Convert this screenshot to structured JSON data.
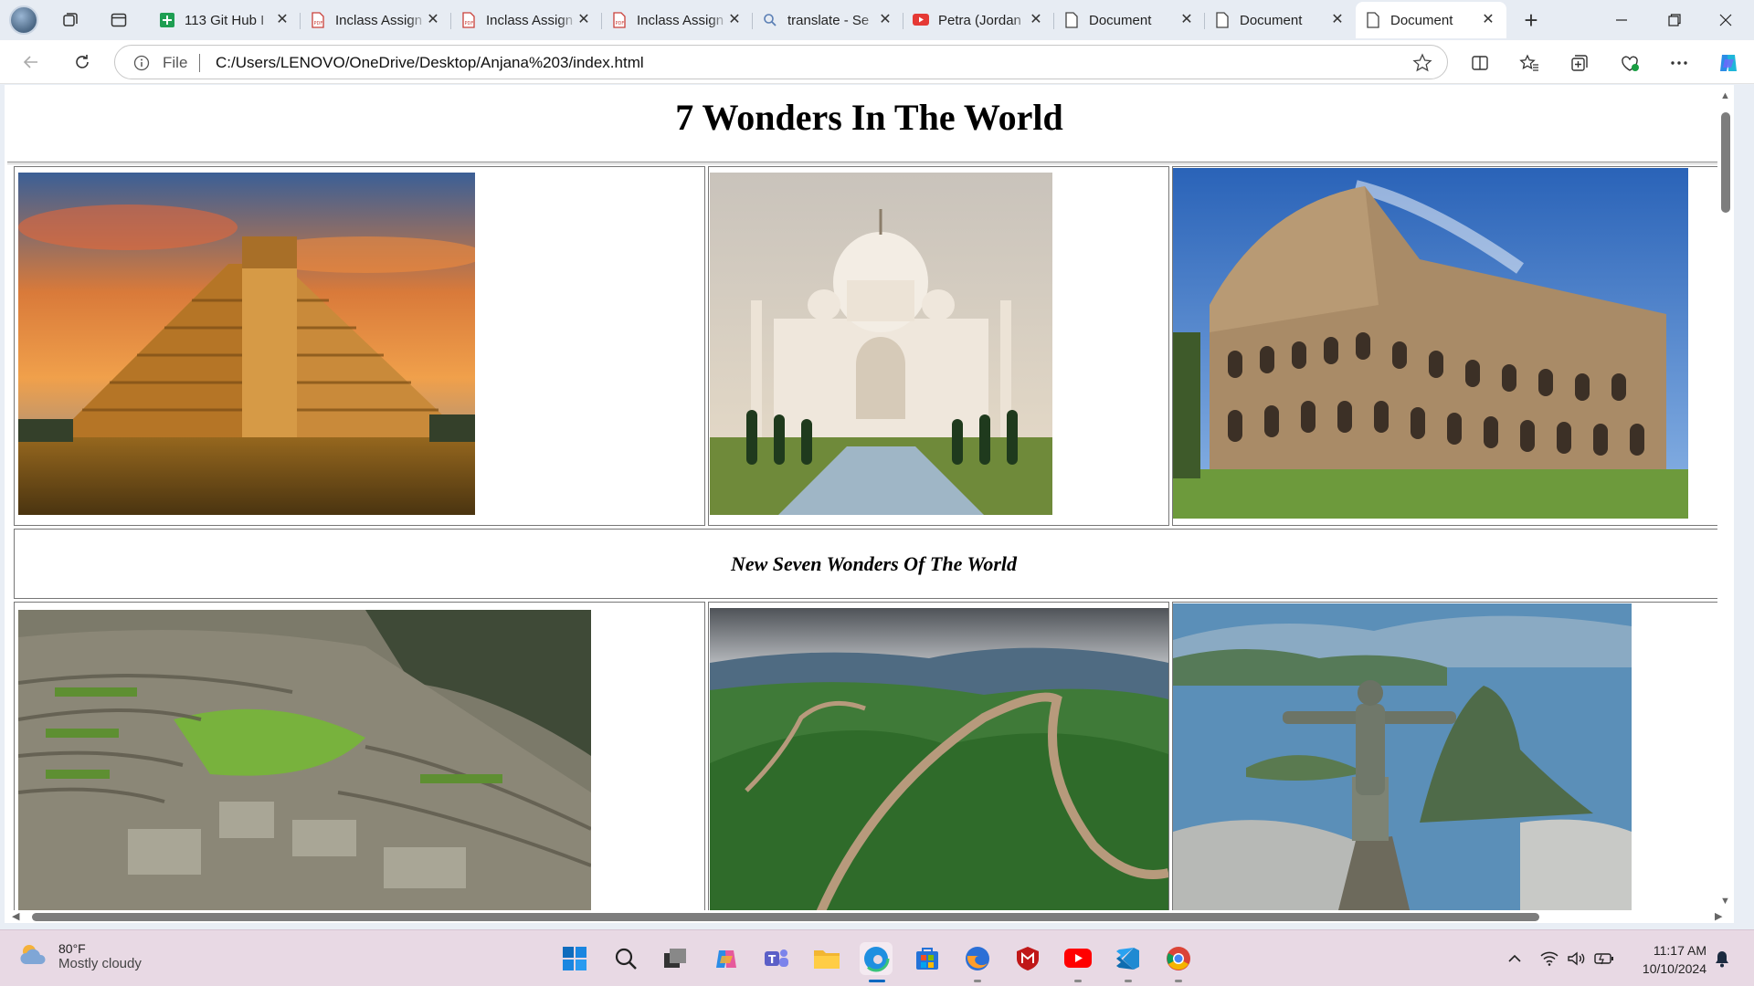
{
  "browser": {
    "tabs": [
      {
        "title": "113 Git Hub I",
        "icon": "sheet-icon",
        "active": false
      },
      {
        "title": "Inclass Assign",
        "icon": "pdf-icon",
        "active": false
      },
      {
        "title": "Inclass Assign",
        "icon": "pdf-icon",
        "active": false
      },
      {
        "title": "Inclass Assign",
        "icon": "pdf-icon",
        "active": false
      },
      {
        "title": "translate - Se",
        "icon": "search-icon",
        "active": false
      },
      {
        "title": "Petra (Jordan",
        "icon": "youtube-icon",
        "active": false
      },
      {
        "title": "Document",
        "icon": "document-icon",
        "active": false
      },
      {
        "title": "Document",
        "icon": "document-icon",
        "active": false
      },
      {
        "title": "Document",
        "icon": "document-icon",
        "active": true
      }
    ],
    "address": {
      "scheme_label": "File",
      "url": "C:/Users/LENOVO/OneDrive/Desktop/Anjana%203/index.html"
    }
  },
  "page": {
    "heading": "7 Wonders In The World",
    "caption": "New Seven Wonders Of The World",
    "photos": [
      {
        "name": "chichen-itza-photo",
        "subject": "Step pyramid at sunset"
      },
      {
        "name": "taj-mahal-photo",
        "subject": "White marble mausoleum with reflecting pool"
      },
      {
        "name": "colosseum-photo",
        "subject": "Roman amphitheatre"
      },
      {
        "name": "machu-picchu-photo",
        "subject": "Mountain ruins with terraces"
      },
      {
        "name": "great-wall-photo",
        "subject": "Wall winding over green mountains"
      },
      {
        "name": "christ-redeemer-photo",
        "subject": "Statue above bay"
      }
    ]
  },
  "taskbar": {
    "weather_temp": "80°F",
    "weather_condition": "Mostly cloudy",
    "time": "11:17 AM",
    "date": "10/10/2024"
  },
  "colors": {
    "accent": "#0067c0",
    "taskbar": "#e8d9e4"
  }
}
